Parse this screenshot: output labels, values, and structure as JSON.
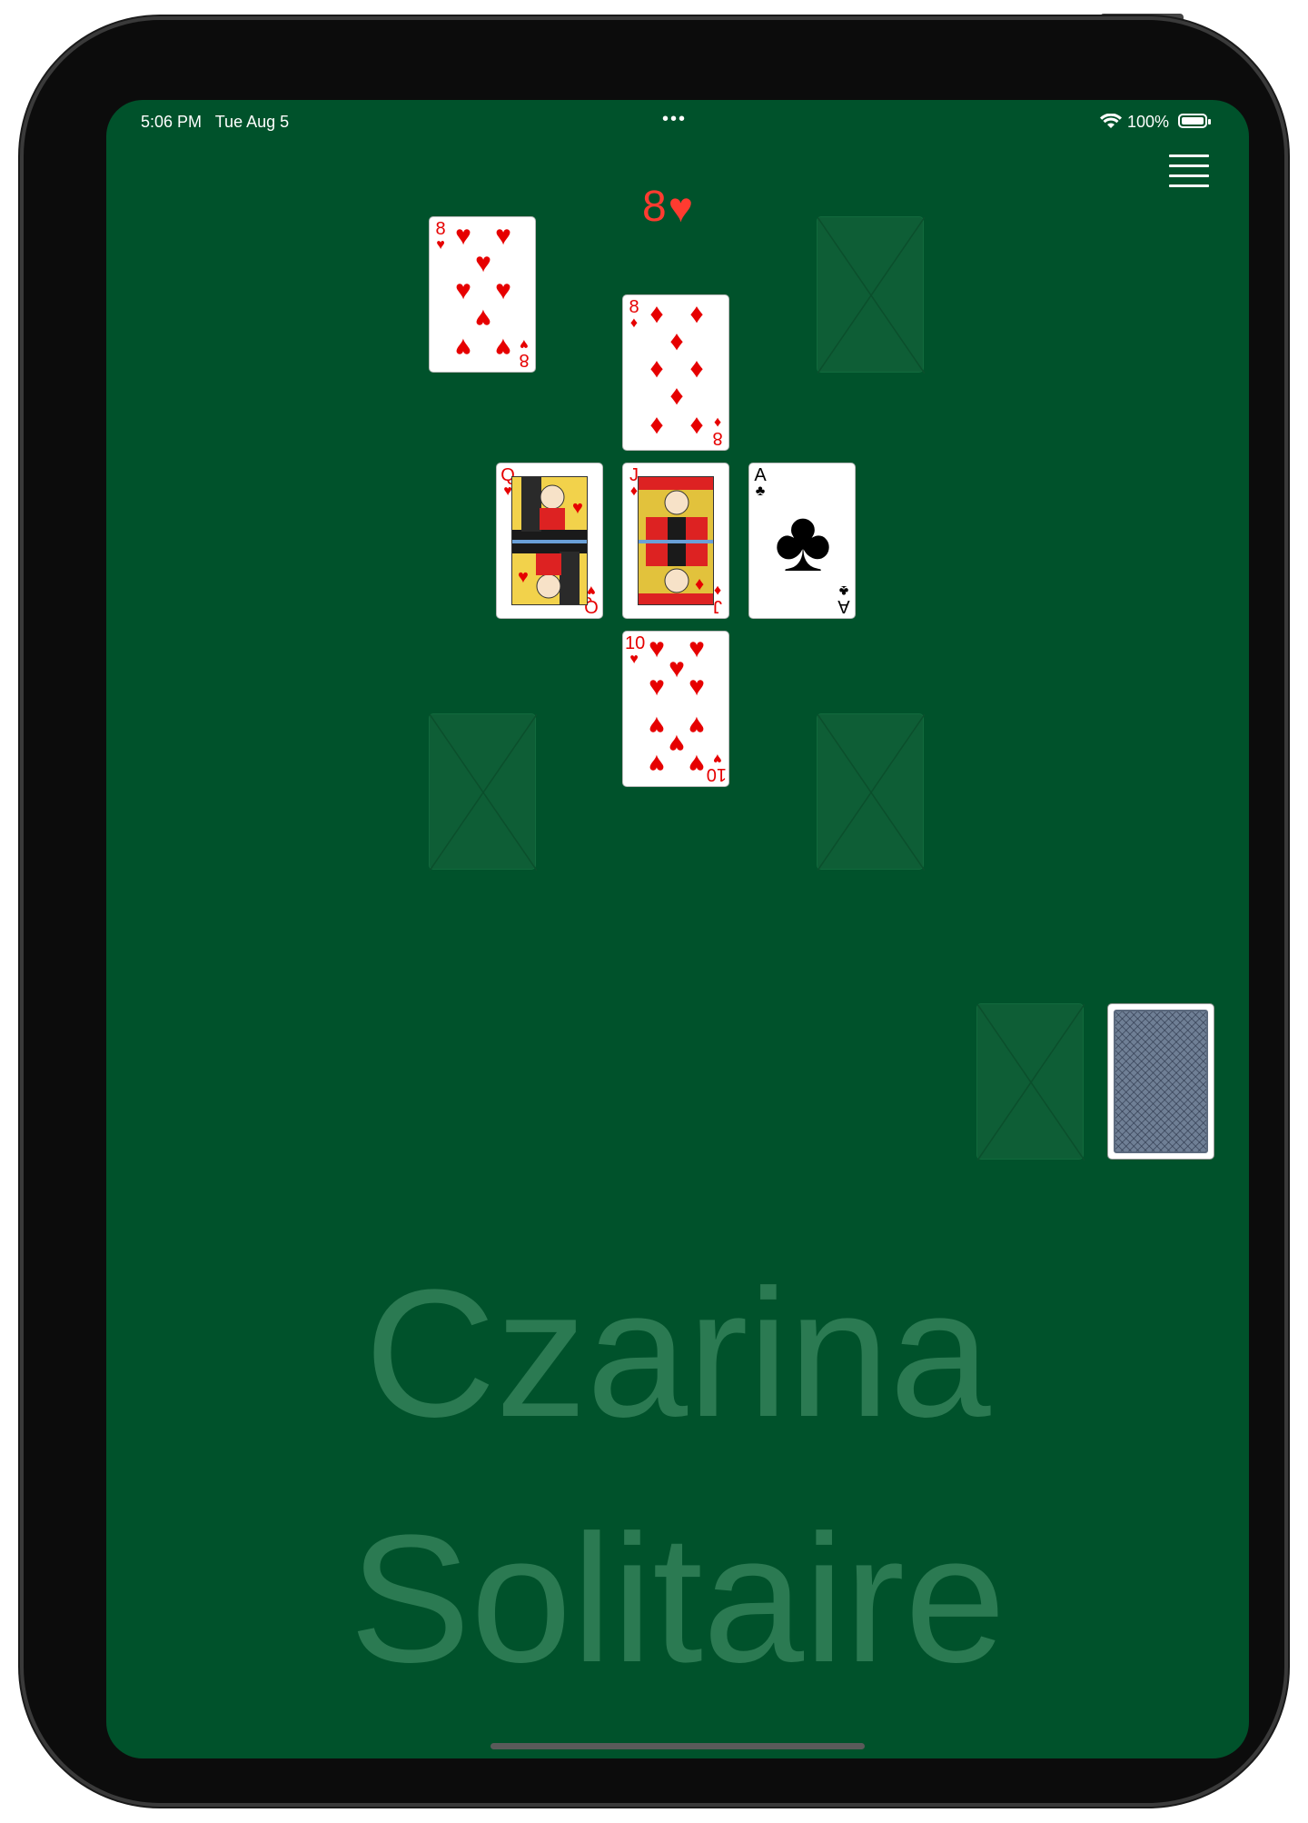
{
  "status_bar": {
    "time": "5:06 PM",
    "date": "Tue Aug 5",
    "dots": "•••",
    "battery": "100%"
  },
  "game": {
    "target_rank": "8",
    "target_suit": "♥",
    "watermark_line1": "Czarina",
    "watermark_line2": "Solitaire",
    "colors": {
      "table": "#00522b",
      "slot": "#0e5e36",
      "red_suit": "#e60000",
      "target_text": "#ff3b30"
    },
    "cards": {
      "top_left": {
        "rank": "8",
        "suit": "♥"
      },
      "center_top": {
        "rank": "8",
        "suit": "♦"
      },
      "center_left": {
        "rank": "Q",
        "suit": "♥"
      },
      "center": {
        "rank": "J",
        "suit": "♦"
      },
      "center_right": {
        "rank": "A",
        "suit": "♣"
      },
      "center_bottom": {
        "rank": "10",
        "suit": "♥"
      }
    },
    "empty_slots": [
      "top-right",
      "bottom-left",
      "bottom-right",
      "waste"
    ],
    "stock": "face-down"
  },
  "icons": {
    "menu": "hamburger-menu-icon",
    "wifi": "wifi-icon",
    "battery": "battery-icon"
  }
}
